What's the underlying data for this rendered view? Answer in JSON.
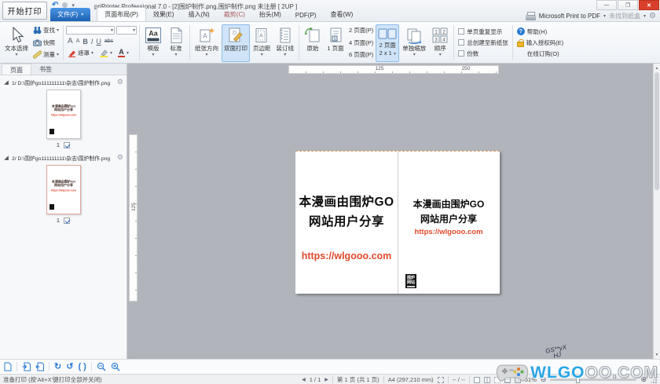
{
  "window": {
    "title": "priPrinter Professional 7.0 - [2]围炉制作.png,围炉制作.png 未注册 [ 2UP ]",
    "start_print": "开始打印",
    "minimize": "—",
    "maximize": "❐",
    "close": "✕"
  },
  "printerbar": {
    "printer": "Microsoft Print to PDF",
    "tray": "未找到纸盒",
    "gear_icon": "gear-icon"
  },
  "tabs": {
    "file": "文件(F)",
    "layout": "页面布局(P)",
    "effects": "效果(E)",
    "insert": "插入(N)",
    "crop": "裁剪(C)",
    "header": "抬头(M)",
    "pdf": "PDF(P)",
    "view": "查看(W)"
  },
  "ribbon": {
    "text_select": "文本选择",
    "find": "查找",
    "snapshot": "快照",
    "measure": "测量",
    "mask": "遮罩",
    "template": "模版",
    "standard": "标准",
    "orientation": "纸张方向",
    "duplex": "双面打印",
    "margins": "页边距",
    "gutter": "装订线",
    "original": "原始",
    "one_page": "1 页面",
    "pages2": "2 页面(P)",
    "pages4": "4 页面(P)",
    "pages6": "6 页面(P)",
    "two_pages": "2 页面",
    "two_pages_layout": "2 x 1",
    "scale_sep": "单独缩放",
    "order": "顺序",
    "chk_repeat": "单页重复显示",
    "chk_newsheet": "总创建至新纸张",
    "chk_copies": "份数",
    "help": "帮助(H)",
    "license": "输入授权码(E)",
    "buy": "在线订购(O)"
  },
  "sidebar": {
    "tab_pages": "页面",
    "tab_bookmarks": "书签",
    "items": [
      {
        "label": "1/ D:\\围炉go111111111\\杂志\\围炉制作.png",
        "num": "1"
      },
      {
        "label": "2/ D:\\围炉go111111111\\杂志\\围炉制作.png",
        "num": "1"
      }
    ]
  },
  "preview": {
    "hruler": {
      "t125": "125",
      "t250": "250"
    },
    "vruler": {
      "t125": "125"
    },
    "left_page": {
      "line1": "本漫画由围炉GO",
      "line2": "网站用户分享",
      "url": "https://wlgooo.com"
    },
    "right_page": {
      "line1": "本漫画由围炉GO",
      "line2": "网站用户分享",
      "url": "https://wlgooo.com",
      "stamp1": "围炉",
      "stamp2": "网站"
    }
  },
  "statusbar": {
    "ready": "准备打印 (按'Alt+X'键打印全部并关闭)",
    "nav": "1 / 1",
    "page": "第 1 页 (共 1 页)",
    "paper": "A4 (297,210 mm)",
    "pos": "-- / --",
    "zoom": "51%"
  },
  "watermark": {
    "solid": "WLGO",
    "outline": "OO.COM",
    "scribble1": "GS**yX",
    "scribble2": "HJ"
  },
  "colors": {
    "accent": "#2b7cd3",
    "url_red": "#e04a2c",
    "close_red": "#d9402c",
    "selected_ribbon": "#cfe4f9"
  }
}
